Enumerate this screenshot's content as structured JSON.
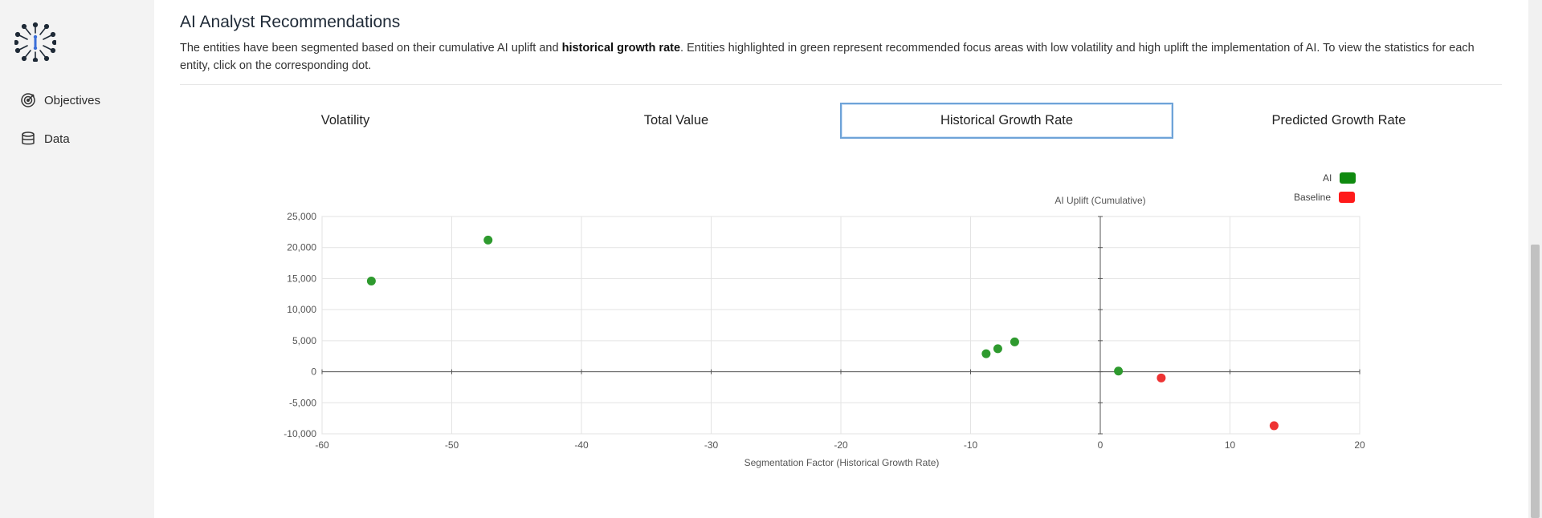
{
  "nav": {
    "items": [
      {
        "label": "Objectives",
        "icon": "target-icon"
      },
      {
        "label": "Data",
        "icon": "database-icon"
      }
    ]
  },
  "header": {
    "title": "AI Analyst Recommendations",
    "desc_part1": "The entities have been segmented based on their cumulative AI uplift and ",
    "desc_bold": "historical growth rate",
    "desc_part2": ". Entities highlighted in green represent recommended focus areas with low volatility and high uplift the implementation of AI. To view the statistics for each entity, click on the corresponding dot."
  },
  "tabs": [
    {
      "label": "Volatility",
      "active": false
    },
    {
      "label": "Total Value",
      "active": false
    },
    {
      "label": "Historical Growth Rate",
      "active": true
    },
    {
      "label": "Predicted Growth Rate",
      "active": false
    }
  ],
  "colors": {
    "ai": "#2e9a2e",
    "baseline": "#ee3333",
    "legend_ai": "#0f8a0f",
    "legend_baseline": "#ff1a1a"
  },
  "chart_data": {
    "type": "scatter",
    "title": "",
    "xlabel": "Segmentation Factor (Historical Growth Rate)",
    "ylabel": "AI Uplift (Cumulative)",
    "xlim": [
      -60,
      20
    ],
    "ylim": [
      -10000,
      25000
    ],
    "x_ticks": [
      -60,
      -50,
      -40,
      -30,
      -20,
      -10,
      0,
      10,
      20
    ],
    "y_ticks": [
      {
        "value": 25000,
        "label": "25,000"
      },
      {
        "value": 20000,
        "label": "20,000"
      },
      {
        "value": 15000,
        "label": "15,000"
      },
      {
        "value": 10000,
        "label": "10,000"
      },
      {
        "value": 5000,
        "label": "5,000"
      },
      {
        "value": 0,
        "label": "0"
      },
      {
        "value": -5000,
        "label": "-5,000"
      },
      {
        "value": -10000,
        "label": "-10,000"
      }
    ],
    "grid": true,
    "legend_position": "top-right",
    "series": [
      {
        "name": "AI",
        "color": "#2e9a2e",
        "points": [
          {
            "x": -56.2,
            "y": 14600
          },
          {
            "x": -47.2,
            "y": 21200
          },
          {
            "x": -8.8,
            "y": 2900
          },
          {
            "x": -7.9,
            "y": 3700
          },
          {
            "x": -6.6,
            "y": 4800
          },
          {
            "x": 1.4,
            "y": 100
          }
        ]
      },
      {
        "name": "Baseline",
        "color": "#ee3333",
        "points": [
          {
            "x": 4.7,
            "y": -1000
          },
          {
            "x": 13.4,
            "y": -8700
          }
        ]
      }
    ]
  }
}
